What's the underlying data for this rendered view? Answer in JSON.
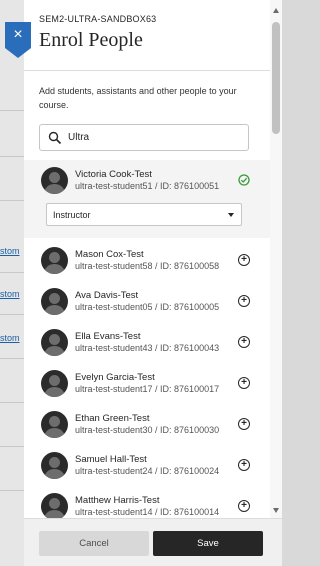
{
  "background": {
    "links": [
      "stom",
      "stom",
      "stom"
    ]
  },
  "panel": {
    "course_id": "SEM2-ULTRA-SANDBOX63",
    "title": "Enrol People",
    "description": "Add students, assistants and other people to your course.",
    "close_label": "×"
  },
  "search": {
    "value": "Ultra",
    "icon": "search-icon"
  },
  "selected_user": {
    "name": "Victoria Cook-Test",
    "sub": "ultra-test-student51 / ID: 876100051",
    "role": "Instructor",
    "status_icon": "check-circle-icon"
  },
  "users": [
    {
      "name": "Mason Cox-Test",
      "sub": "ultra-test-student58 / ID: 876100058"
    },
    {
      "name": "Ava Davis-Test",
      "sub": "ultra-test-student05 / ID: 876100005"
    },
    {
      "name": "Ella Evans-Test",
      "sub": "ultra-test-student43 / ID: 876100043"
    },
    {
      "name": "Evelyn Garcia-Test",
      "sub": "ultra-test-student17 / ID: 876100017"
    },
    {
      "name": "Ethan Green-Test",
      "sub": "ultra-test-student30 / ID: 876100030"
    },
    {
      "name": "Samuel Hall-Test",
      "sub": "ultra-test-student24 / ID: 876100024"
    },
    {
      "name": "Matthew Harris-Test",
      "sub": "ultra-test-student14 / ID: 876100014"
    }
  ],
  "footer": {
    "cancel_label": "Cancel",
    "save_label": "Save"
  },
  "colors": {
    "accent": "#2a6ebb",
    "check": "#3a9a3a",
    "save_bg": "#262626"
  }
}
